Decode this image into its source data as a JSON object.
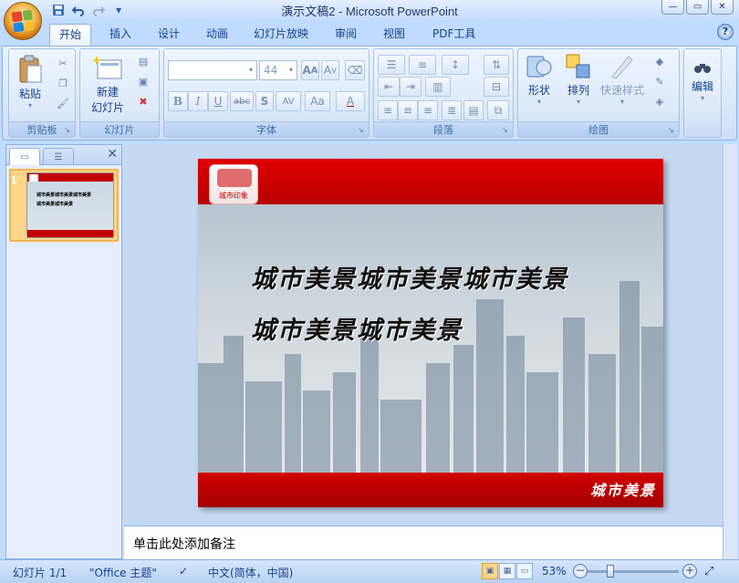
{
  "window": {
    "title": "演示文稿2 - Microsoft PowerPoint",
    "controls": {
      "minimize": "—",
      "restore": "▭",
      "close": "✕"
    }
  },
  "quick_access": [
    {
      "name": "save-icon"
    },
    {
      "name": "undo-icon"
    },
    {
      "name": "redo-icon"
    },
    {
      "name": "customize-icon"
    }
  ],
  "tabs": [
    "开始",
    "插入",
    "设计",
    "动画",
    "幻灯片放映",
    "审阅",
    "视图",
    "PDF工具"
  ],
  "active_tab": "开始",
  "ribbon": {
    "clipboard": {
      "label": "剪贴板",
      "paste": "粘贴"
    },
    "slides": {
      "label": "幻灯片",
      "new_slide_line1": "新建",
      "new_slide_line2": "幻灯片"
    },
    "font": {
      "label": "字体",
      "font_name": "",
      "font_size": "44",
      "bold": "B",
      "italic": "I",
      "underline": "U",
      "strike": "abc",
      "shadow": "S",
      "spacing": "AV",
      "case": "Aa",
      "color": "A"
    },
    "paragraph": {
      "label": "段落"
    },
    "drawing": {
      "label": "绘图",
      "shapes": "形状",
      "arrange": "排列",
      "quick_styles": "快速样式"
    },
    "editing": {
      "label": "编辑"
    }
  },
  "slide_panel": {
    "thumb_number": "1"
  },
  "slide": {
    "logo_text": "城市印象",
    "line1": "城市美景城市美景城市美景",
    "line2": "城市美景城市美景",
    "footer": "城市美景"
  },
  "notes_placeholder": "单击此处添加备注",
  "status": {
    "slide": "幻灯片 1/1",
    "theme": "\"Office 主题\"",
    "language": "中文(简体，中国)",
    "zoom": "53%"
  },
  "colors": {
    "ribbon_bg": "#dbe8fa",
    "slide_red": "#c00000",
    "accent_orange": "#f6b552"
  }
}
